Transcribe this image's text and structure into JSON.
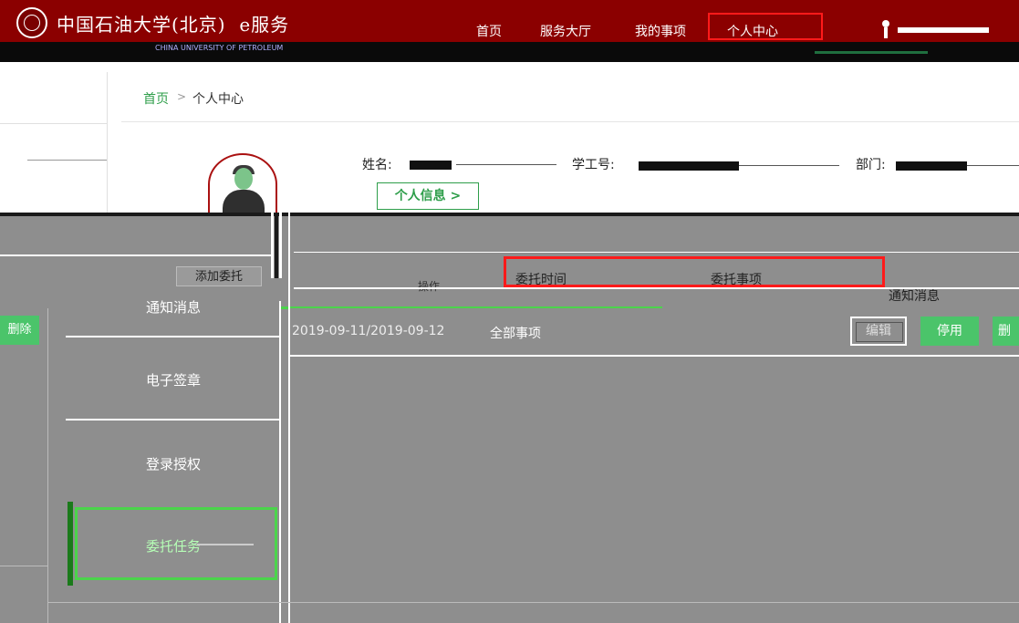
{
  "header": {
    "logo_text": "中国石油大学(北京)",
    "brand": "e服务",
    "logo_sub": "CHINA UNIVERSITY OF PETROLEUM",
    "nav": {
      "home": "首页",
      "service_hall": "服务大厅",
      "my_items": "我的事项",
      "personal_center": "个人中心"
    }
  },
  "breadcrumb": {
    "home": "首页",
    "separator": ">",
    "current": "个人中心"
  },
  "profile": {
    "name_label": "姓名:",
    "student_id_label": "学工号:",
    "department_label": "部门:",
    "personal_info_button": "个人信息 >"
  },
  "toolbar": {
    "add_delegate": "添加委托",
    "delete_left": "删除"
  },
  "table": {
    "headers": {
      "time": "委托时间",
      "item": "委托事项",
      "misc": "操作"
    },
    "rows": [
      {
        "date_range": "2019-09-11/2019-09-12",
        "scope": "全部事项",
        "actions": {
          "edit": "编辑",
          "disable": "停用",
          "delete": "删除"
        }
      }
    ]
  },
  "sidebar": {
    "items": [
      {
        "label": "通知消息"
      },
      {
        "label": "电子签章"
      },
      {
        "label": "登录授权"
      },
      {
        "label": "委托任务",
        "active": true
      }
    ]
  },
  "notice_message": "通知消息",
  "colors": {
    "header_bg": "#8b0000",
    "accent_green": "#4bc46a",
    "highlight_red": "#ff1a1a",
    "overlay_grey": "#8e8e8e"
  }
}
